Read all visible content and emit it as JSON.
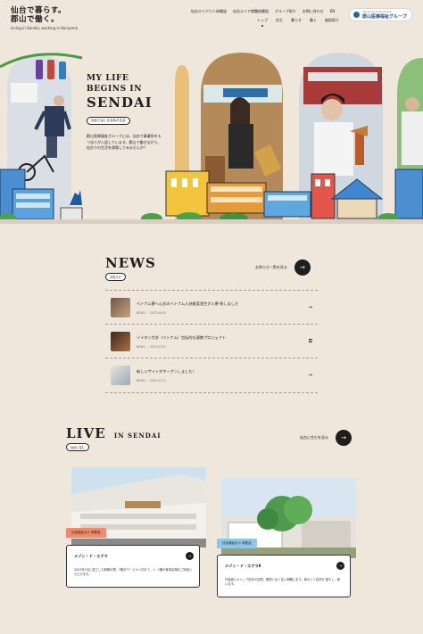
{
  "header": {
    "logo_line1": "仙台で暮らす。",
    "logo_line2": "郡山で働く。",
    "logo_sub": "Living in Sendai, working in Koriyama",
    "nav_top": [
      "仙台エリア二人体験談",
      "仙台エリア就職体験談",
      "グループ紹介",
      "お問い合わせ",
      "EN"
    ],
    "nav_bottom": [
      "トップ",
      "住む",
      "暮らす",
      "働く",
      "施設紹介"
    ],
    "corp_small": "Sendai Kouseikai Group",
    "corp_name": "郡山医療福祉グループ"
  },
  "hero": {
    "title_line1": "MY LIFE",
    "title_line2": "BEGINS IN",
    "title_line3": "SENDAI",
    "tag": "仙台ではじまる私の生活",
    "body": "郡山医療福祉グループには、仙台で事業所をもつ法人が入居しています。郡山で働きながら、仙台での生活を満喫してみませんか？"
  },
  "news": {
    "title": "NEWS",
    "pill": "お知らせ",
    "more_label": "お知らせ一覧を見る",
    "items": [
      {
        "title": "ベトナム夢へ心志のベトナム人技能実習生が入寮 致しました",
        "category": "NEWS",
        "date": "2023.06.05",
        "icon": "arrow-right-icon"
      },
      {
        "title": "ゾイタン大学（ベトナム）包括的な連携プロジェクト",
        "category": "NEWS",
        "date": "2023.02.01",
        "icon": "external-link-icon"
      },
      {
        "title": "新しいサイトがオープンしました！",
        "category": "NEWS",
        "date": "2023.01.31",
        "icon": "arrow-right-icon"
      }
    ]
  },
  "live": {
    "title": "LIVE",
    "title_sub": "IN SENDAI",
    "pill": "仙台に住む",
    "more_label": "仙台に住むを見る",
    "cards": [
      {
        "label": "社会福祉法人 明愛会",
        "name": "メゾン・ド・エクラ",
        "body": "2023年1月に竣工した新築の寮。3階タワービルへ向けて、1・2階が食事会場をご利用いただけます。",
        "label_color": "#f08a6a"
      },
      {
        "label": "社会福祉法人 明愛会",
        "name": "メゾン・ド・エクラⅡ",
        "body": "外装板とキャップ的手の空間、職員と近く住い和職にます。静かして自然が 望もし、新います。",
        "label_color": "#8fc6e6"
      }
    ]
  },
  "colors": {
    "background": "#efe6dc",
    "dark": "#1e1e1e"
  }
}
